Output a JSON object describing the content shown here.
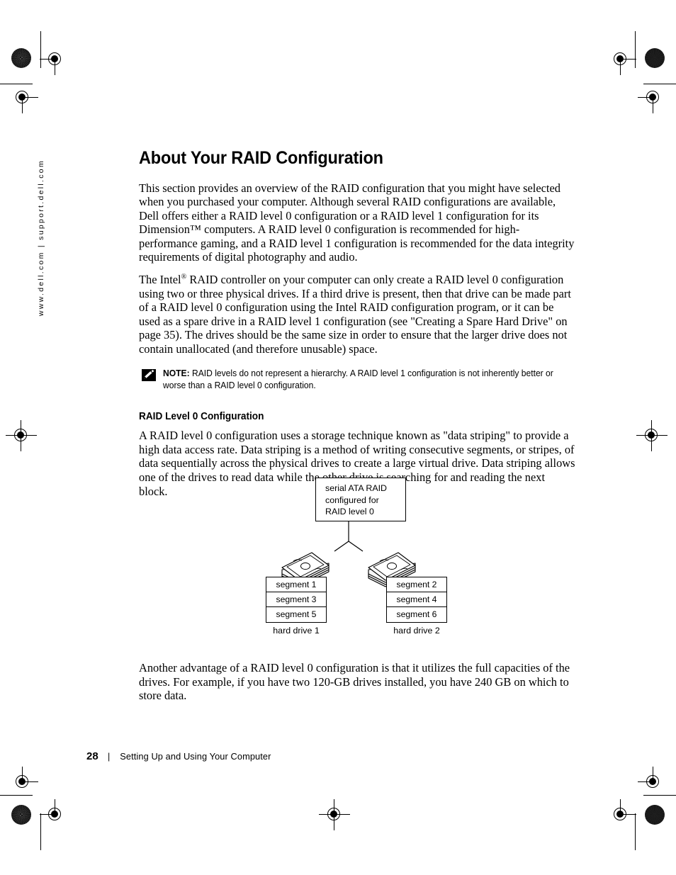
{
  "spine": {
    "text": "www.dell.com | support.dell.com"
  },
  "content": {
    "title": "About Your RAID Configuration",
    "paragraph_1": "This section provides an overview of the RAID configuration that you might have selected when you purchased your computer. Although several RAID configurations are available, Dell offers either a RAID level 0 configuration or a RAID level 1 configuration for its Dimension™ computers. A RAID level 0 configuration is recommended for high-performance gaming, and a RAID level 1 configuration is recommended for the data integrity requirements of digital photography and audio.",
    "paragraph_2_pre": "The Intel",
    "paragraph_2_sup": "®",
    "paragraph_2_post": " RAID controller on your computer can only create a RAID level 0 configuration using two or three physical drives. If a third drive is present, then that drive can be made part of a RAID level 0 configuration using the Intel RAID configuration program, or it can be used as a spare drive in a RAID level 1 configuration (see \"Creating a Spare Hard Drive\" on page 35). The drives should be the same size in order to ensure that the larger drive does not contain unallocated (and therefore unusable) space.",
    "note_label": "NOTE:",
    "note_text": " RAID levels do not represent a hierarchy. A RAID level 1 configuration is not inherently better or worse than a RAID level 0 configuration.",
    "subheading": "RAID Level 0 Configuration",
    "paragraph_3": "A RAID level 0 configuration uses a storage technique known as \"data striping\" to provide a high data access rate. Data striping is a method of writing consecutive segments, or stripes, of data sequentially across the physical drives to create a large virtual drive. Data striping allows one of the drives to read data while the other drive is searching for and reading the next block.",
    "paragraph_4": "Another advantage of a RAID level 0 configuration is that it utilizes the full capacities of the drives. For example, if you have two 120-GB drives installed, you have 240 GB on which to store data."
  },
  "diagram": {
    "callout_line_1": "serial ATA RAID",
    "callout_line_2": "configured for",
    "callout_line_3": "RAID level 0",
    "drive_1": {
      "label": "hard drive 1",
      "segments": [
        "segment 1",
        "segment 3",
        "segment 5"
      ]
    },
    "drive_2": {
      "label": "hard drive 2",
      "segments": [
        "segment 2",
        "segment 4",
        "segment 6"
      ]
    }
  },
  "footer": {
    "page_number": "28",
    "separator": "|",
    "section": "Setting Up and Using Your Computer"
  }
}
